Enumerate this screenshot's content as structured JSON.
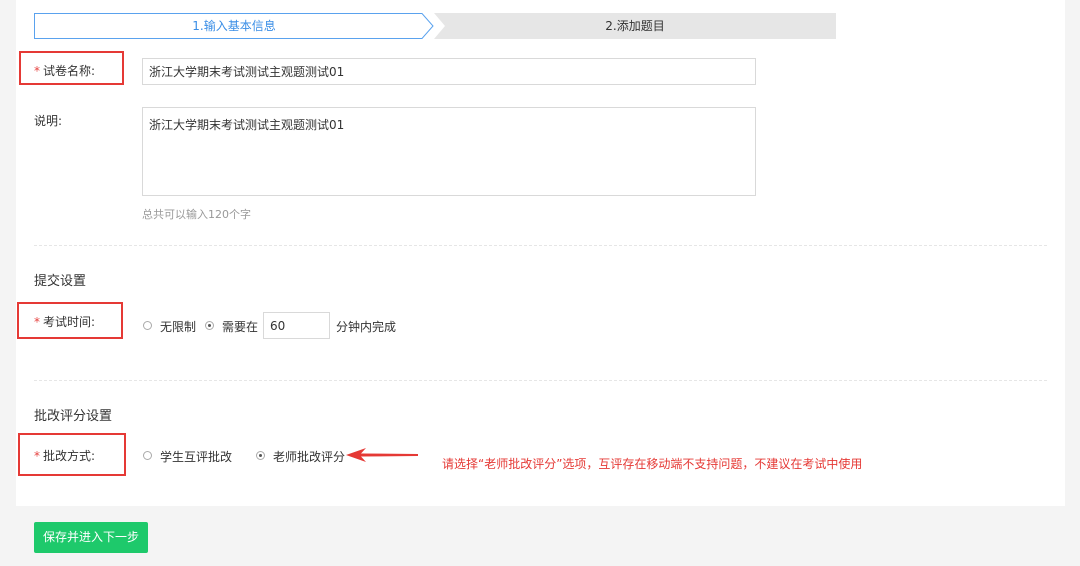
{
  "steps": [
    {
      "label": "1.输入基本信息",
      "active": true
    },
    {
      "label": "2.添加题目",
      "active": false
    }
  ],
  "form": {
    "required_mark": "*",
    "name_label": "试卷名称:",
    "name_value": "浙江大学期末考试测试主观题测试01",
    "desc_label": "说明:",
    "desc_value": "浙江大学期末考试测试主观题测试01",
    "desc_hint": "总共可以输入120个字"
  },
  "submit_settings": {
    "title": "提交设置",
    "time_label": "考试时间:",
    "option_unlimited": "无限制",
    "option_limited_prefix": "需要在",
    "minutes_value": "60",
    "option_limited_suffix": "分钟内完成",
    "selected": "limited"
  },
  "grading_settings": {
    "title": "批改评分设置",
    "method_label": "批改方式:",
    "option_peer": "学生互评批改",
    "option_teacher": "老师批改评分",
    "selected": "teacher",
    "annotation": "请选择“老师批改评分”选项，互评存在移动端不支持问题，不建议在考试中使用"
  },
  "footer": {
    "save_next_label": "保存并进入下一步"
  },
  "colors": {
    "accent_blue": "#3a8ee6",
    "required_red": "#e64340",
    "highlight_red": "#e53935",
    "button_green": "#1ec96b"
  }
}
